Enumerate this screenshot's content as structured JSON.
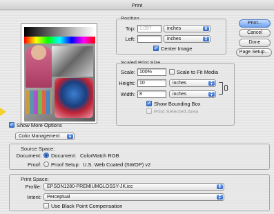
{
  "window": {
    "title": "Print"
  },
  "buttons": {
    "print": "Print...",
    "cancel": "Cancel",
    "done": "Done",
    "page_setup": "Page Setup..."
  },
  "position": {
    "group_label": "Position",
    "top_label": "Top:",
    "top_value": "1.097",
    "top_unit": "inches",
    "left_label": "Left:",
    "left_value": "",
    "left_unit": "inches",
    "center_image_label": "Center Image",
    "center_image_checked": true
  },
  "scaled": {
    "group_label": "Scaled Print Size",
    "scale_label": "Scale:",
    "scale_value": "100%",
    "scale_to_fit_label": "Scale to Fit Media",
    "height_label": "Height:",
    "height_value": "10",
    "height_unit": "inches",
    "width_label": "Width:",
    "width_value": "8",
    "width_unit": "inches",
    "show_bounding_box_label": "Show Bounding Box",
    "show_bounding_box_checked": true,
    "print_selected_area_label": "Print Selected Area"
  },
  "more": {
    "show_more_label": "Show More Options",
    "show_more_checked": true,
    "section_popup": "Color Management"
  },
  "source_space": {
    "group_label": "Source Space:",
    "document_label": "Document:",
    "document_option": "Document:",
    "document_value": "ColorMatch RGB",
    "proof_label": "Proof:",
    "proof_option": "Proof Setup:",
    "proof_value": "U.S. Web Coated (SWOP) v2"
  },
  "print_space": {
    "group_label": "Print Space:",
    "profile_label": "Profile:",
    "profile_value": "EPSON1280-PREMIUMGLOSSY-JK.icc",
    "intent_label": "Intent:",
    "intent_value": "Perceptual",
    "bpc_label": "Use Black Point Compensation"
  }
}
